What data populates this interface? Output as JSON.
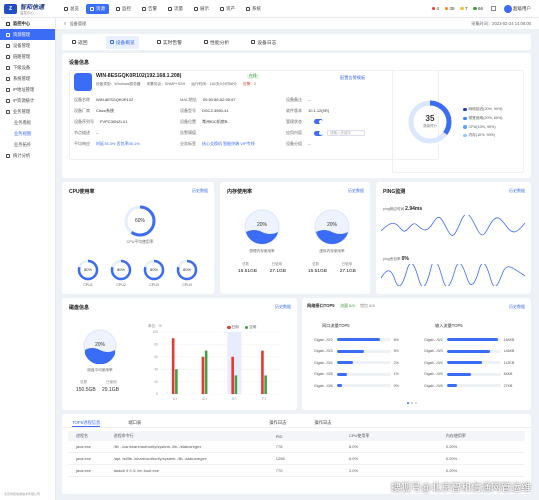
{
  "app": {
    "brand": "智和信通",
    "subtitle": "监控中心"
  },
  "topnav": [
    {
      "label": "总览",
      "icon": "home-icon"
    },
    {
      "label": "资源",
      "icon": "server-icon"
    },
    {
      "label": "监控",
      "icon": "monitor-icon"
    },
    {
      "label": "告警",
      "icon": "bell-icon"
    },
    {
      "label": "流量",
      "icon": "flow-icon"
    },
    {
      "label": "展示",
      "icon": "display-icon"
    },
    {
      "label": "资产",
      "icon": "box-icon"
    },
    {
      "label": "系统",
      "icon": "gear-icon"
    }
  ],
  "alerts": [
    {
      "value": "4",
      "color": "#e53935"
    },
    {
      "value": "39",
      "color": "#fb8c00"
    },
    {
      "value": "7",
      "color": "#fbc02d"
    },
    {
      "value": "66",
      "color": "#43a047"
    }
  ],
  "user": {
    "name": "超级用户"
  },
  "sidebar": {
    "header": "监控中心",
    "items": [
      {
        "label": "资源管理",
        "active": true
      },
      {
        "label": "设备管理"
      },
      {
        "label": "链路管理"
      },
      {
        "label": "下级设备"
      },
      {
        "label": "系统管理"
      },
      {
        "label": "IP地址管理"
      },
      {
        "label": "IP资源统计"
      },
      {
        "label": "业务管理"
      },
      {
        "label": "业务看板",
        "sub": true
      },
      {
        "label": "业务视图",
        "sub": true,
        "sel": true
      },
      {
        "label": "业务拓扑",
        "sub": true
      },
      {
        "label": "统计分析"
      }
    ],
    "footer": "北京智和信通技术有限公司"
  },
  "breadcrumb": "设备管理",
  "datetime": "采集时间：2023-02-24 14:06:00",
  "tabs": [
    {
      "label": "返回"
    },
    {
      "label": "设备概览",
      "active": true
    },
    {
      "label": "实时告警"
    },
    {
      "label": "性能分析"
    },
    {
      "label": "设备日志"
    }
  ],
  "device": {
    "section": "设备信息",
    "name": "WIN-8ESGQK0R102(192.168.1.208)",
    "status": "在线",
    "meta1": "设备类型：Windows服务器",
    "meta2": "采集协议：SNMP+SSH",
    "meta3": "运行时间：182天4小时58分",
    "meta4": "告警：2",
    "alert_link": "配置告警模板",
    "fields": [
      {
        "k": "设备名称",
        "v": "WIN-8ESGQK0R102"
      },
      {
        "k": "MAC地址",
        "v": "00:50:56:A2:00:97"
      },
      {
        "k": "设备备注",
        "v": "--"
      },
      {
        "k": "设备厂商",
        "v": "Cisco系统"
      },
      {
        "k": "设备型号",
        "v": "DSC2-3550-41"
      },
      {
        "k": "软件版本",
        "v": "10.1.12(0R)"
      },
      {
        "k": "设备序列号",
        "v": "FVPC30NZLX1"
      },
      {
        "k": "设备位置",
        "v": "常州IDC机房B"
      },
      {
        "k": "管理状态",
        "v": ""
      },
      {
        "k": "节点描述",
        "v": "--"
      },
      {
        "k": "告警阈值",
        "v": ""
      },
      {
        "k": "应用内容",
        "v": ""
      },
      {
        "k": "平均响应",
        "v": "时延78.3%  丢包率55.1%"
      },
      {
        "k": "业务标签",
        "v": "核心交换机  智能终端  VIP专线"
      },
      {
        "k": "设备分组",
        "v": "--"
      }
    ],
    "search_ph": "请输入关键字"
  },
  "health": {
    "score": "35",
    "label": "健康得分",
    "legend": [
      {
        "label": "网络延迟(20%, 90%)",
        "color": "#1e40af"
      },
      {
        "label": "带宽使用(20%, 60%)",
        "color": "#3b82f6"
      },
      {
        "label": "CPU(10%, 90%)",
        "color": "#60a5fa"
      },
      {
        "label": "内存(10%, 90%)",
        "color": "#93c5fd"
      }
    ]
  },
  "cpu": {
    "title": "CPU使用率",
    "link": "历史数据",
    "avg": "60%",
    "avg_label": "CPU平均使用率",
    "cores": [
      {
        "v": "80%",
        "l": "CPU1"
      },
      {
        "v": "80%",
        "l": "CPU2"
      },
      {
        "v": "80%",
        "l": "CPU3"
      },
      {
        "v": "80%",
        "l": "CPU4"
      }
    ]
  },
  "memory": {
    "title": "内存使用率",
    "link": "历史数据",
    "items": [
      {
        "v": "20%",
        "l": "物理内存使用率",
        "total": "15.51GB",
        "used": "27.1GB"
      },
      {
        "v": "20%",
        "l": "虚拟内存使用率",
        "total": "15.51GB",
        "used": "27.1GB"
      }
    ],
    "total_label": "总数",
    "used_label": "已使用"
  },
  "ping": {
    "title": "PING监测",
    "link": "历史数据",
    "rtt_label": "ping响应时间",
    "rtt": "2.94ms",
    "loss_label": "ping丢包率",
    "loss": "0%"
  },
  "disk": {
    "title": "磁盘信息",
    "link": "历史数据",
    "avg": "20%",
    "avg_label": "磁盘平均使用率",
    "total_label": "总数",
    "used_label": "已使用",
    "total": "150.5GB",
    "used": "29.1GB",
    "unit": "单位：%",
    "legend": [
      {
        "label": "已用",
        "color": "#e53935"
      },
      {
        "label": "空闲",
        "color": "#43a047"
      }
    ],
    "chart_data": {
      "type": "bar",
      "categories": [
        "C:\\",
        "D:\\",
        "E:\\",
        "F:\\"
      ],
      "ylim": [
        0,
        100
      ],
      "series": [
        {
          "name": "已用",
          "values": [
            90,
            60,
            60,
            70
          ]
        },
        {
          "name": "空闲",
          "values": [
            40,
            70,
            30,
            30
          ]
        }
      ]
    }
  },
  "traffic": {
    "title": "网络接口TOP5",
    "tab1": "流量",
    "tab1_count": "8/8",
    "tab2": "错包",
    "tab2_count": "8/8",
    "link": "历史数据",
    "col1": "网口流量TOP5",
    "col2": "输入流量TOP5",
    "left": [
      {
        "n": "Gigab.../0/2",
        "v": "8%",
        "p": 0.8
      },
      {
        "n": "Gigab.../0/3",
        "v": "5%",
        "p": 0.5
      },
      {
        "n": "Gigab.../0/4",
        "v": "2%",
        "p": 0.3
      },
      {
        "n": "Gigab.../0/5",
        "v": "1%",
        "p": 0.2
      },
      {
        "n": "Gigab.../0/6",
        "v": "0%",
        "p": 0.1
      }
    ],
    "right": [
      {
        "n": "Gigab.../0/2",
        "v": "184KB",
        "p": 0.95
      },
      {
        "n": "Gigab.../0/3",
        "v": "146KB",
        "p": 0.8
      },
      {
        "n": "Gigab.../0/4",
        "v": "112KB",
        "p": 0.65
      },
      {
        "n": "Gigab.../0/5",
        "v": "84KB",
        "p": 0.45
      },
      {
        "n": "Gigab.../0/6",
        "v": "27KB",
        "p": 0.2
      }
    ]
  },
  "bottom": {
    "tabs": [
      "TOP5进程信息",
      "端口表",
      "操作日志",
      "操作日志"
    ],
    "cols": [
      "进程名",
      "进程命令行",
      "PID",
      "CPU使用率",
      "内存使用率"
    ],
    "rows": [
      {
        "name": "java.exe",
        "cmd": "/lib ../usr/share/authority/system../lib../statusregex",
        "pid": "778",
        "cpu": "8.0%",
        "mem": "0.20%"
      },
      {
        "name": "java.exe",
        "cmd": "/apt. tst/lib../share/authority/system../lib../statusregex",
        "pid": "1256",
        "cpu": "6.0%",
        "mem": "0.20%"
      },
      {
        "name": "java.exe",
        "cmd": "taskctl /f /t /1 /im boot.exe",
        "pid": "770",
        "cpu": "2.0%",
        "mem": "0.20%"
      }
    ]
  },
  "watermark": "搜狐号@北京智和信通网管运维"
}
